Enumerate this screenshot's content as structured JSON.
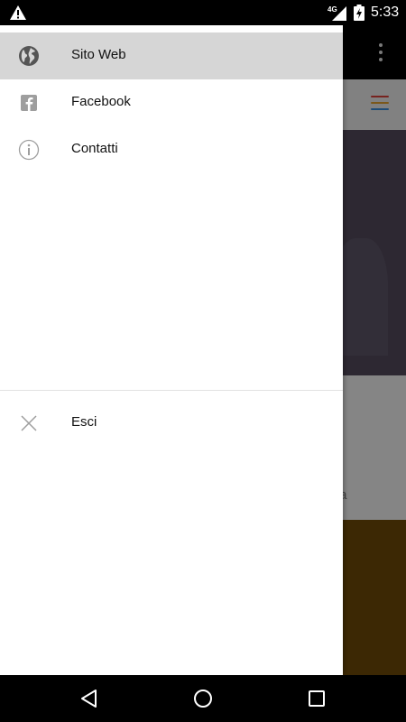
{
  "status_bar": {
    "network": "4G",
    "time": "5:33"
  },
  "drawer": {
    "items": [
      {
        "label": "Sito Web",
        "icon": "globe-icon",
        "selected": true
      },
      {
        "label": "Facebook",
        "icon": "facebook-icon",
        "selected": false
      },
      {
        "label": "Contatti",
        "icon": "info-icon",
        "selected": false
      }
    ],
    "footer_items": [
      {
        "label": "Esci",
        "icon": "close-icon"
      }
    ]
  },
  "background": {
    "snippet": "ta"
  },
  "colors": {
    "status_bar": "#000000",
    "drawer_bg": "#ffffff",
    "selected_item": "#d6d6d6",
    "hero": "#524a5c",
    "banner": "#6d4a08",
    "icon_gray": "#9e9e9e"
  }
}
